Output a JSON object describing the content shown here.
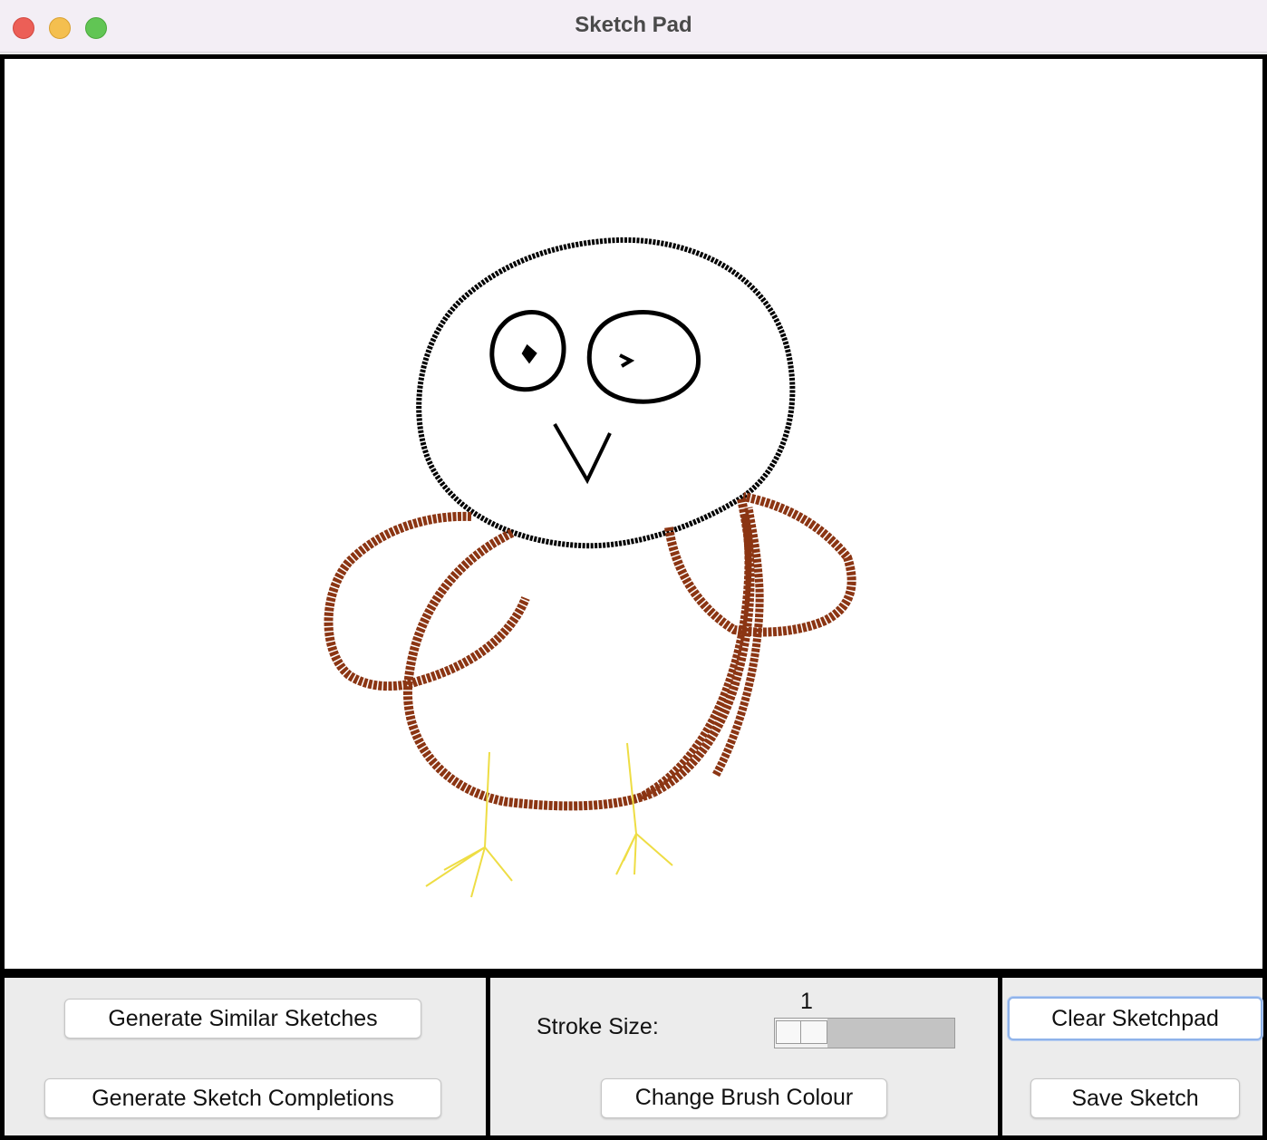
{
  "window": {
    "title": "Sketch Pad"
  },
  "actions": {
    "generate_similar": "Generate Similar Sketches",
    "generate_completions": "Generate Sketch Completions"
  },
  "brush": {
    "stroke_size_label": "Stroke Size:",
    "stroke_size_value": "1",
    "change_colour": "Change Brush Colour"
  },
  "file": {
    "clear": "Clear Sketchpad",
    "save": "Save Sketch"
  },
  "sketch_colors": {
    "outline": "#000000",
    "body": "#8b3513",
    "feet": "#eedd44"
  }
}
